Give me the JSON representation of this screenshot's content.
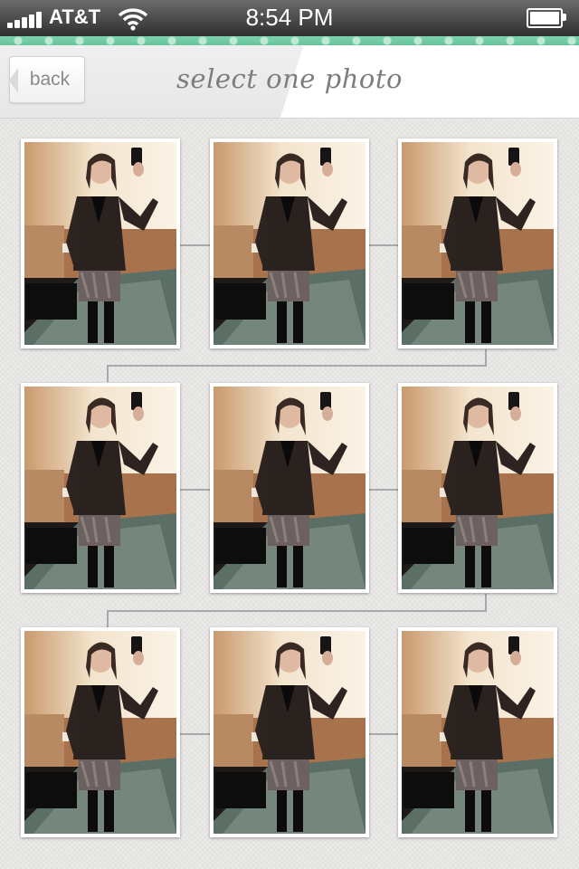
{
  "status_bar": {
    "carrier": "AT&T",
    "time": "8:54 PM",
    "icons": [
      "signal-bars-icon",
      "wifi-icon",
      "battery-icon"
    ]
  },
  "nav": {
    "back_label": "back",
    "title": "select one photo"
  },
  "photos": [
    {
      "name": "photo-1"
    },
    {
      "name": "photo-2"
    },
    {
      "name": "photo-3"
    },
    {
      "name": "photo-4"
    },
    {
      "name": "photo-5"
    },
    {
      "name": "photo-6"
    },
    {
      "name": "photo-7"
    },
    {
      "name": "photo-8"
    },
    {
      "name": "photo-9"
    }
  ],
  "colors": {
    "accent_strip": "#6fc9a2",
    "title_text": "#7d7d7d",
    "back_text": "#8a8a8a"
  }
}
